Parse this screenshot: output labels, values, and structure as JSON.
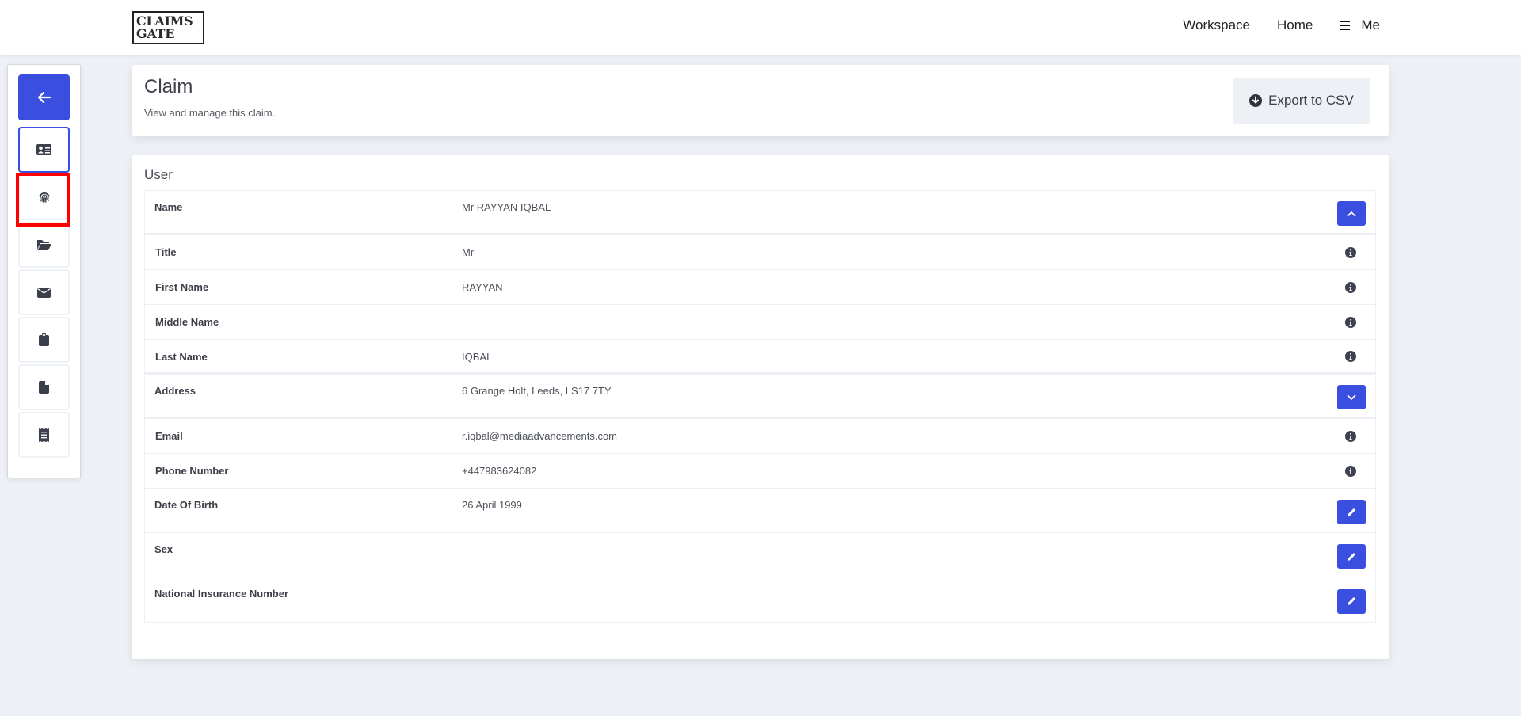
{
  "header": {
    "logo_line1": "CLAIMS",
    "logo_line2": "GATE",
    "nav": [
      {
        "label": "Workspace"
      },
      {
        "label": "Home"
      },
      {
        "label": "Me",
        "icon": "hamburger-icon"
      }
    ]
  },
  "sidebar": {
    "back_icon": "arrow-left-icon",
    "items": [
      {
        "icon": "id-card-icon",
        "active": true
      },
      {
        "icon": "fingerprint-icon",
        "highlighted": true
      },
      {
        "icon": "folder-open-icon"
      },
      {
        "icon": "envelope-icon"
      },
      {
        "icon": "clipboard-icon"
      },
      {
        "icon": "file-icon"
      },
      {
        "icon": "receipt-icon"
      }
    ]
  },
  "page": {
    "title": "Claim",
    "subtitle": "View and manage this claim.",
    "export_label": "Export to CSV",
    "export_icon": "download-circle-icon"
  },
  "user": {
    "section_title": "User",
    "rows": [
      {
        "label": "Name",
        "value": "Mr RAYYAN IQBAL",
        "action": "collapse-button"
      },
      {
        "label": "Title",
        "value": "Mr",
        "action": "info-icon"
      },
      {
        "label": "First Name",
        "value": "RAYYAN",
        "action": "info-icon"
      },
      {
        "label": "Middle Name",
        "value": "",
        "action": "info-icon"
      },
      {
        "label": "Last Name",
        "value": "IQBAL",
        "action": "info-icon"
      },
      {
        "label": "Address",
        "value": "6 Grange Holt, Leeds, LS17 7TY",
        "action": "expand-button"
      },
      {
        "label": "Email",
        "value": "r.iqbal@mediaadvancements.com",
        "action": "info-icon"
      },
      {
        "label": "Phone Number",
        "value": "+447983624082",
        "action": "info-icon"
      },
      {
        "label": "Date Of Birth",
        "value": "26 April 1999",
        "action": "edit-button"
      },
      {
        "label": "Sex",
        "value": "",
        "action": "edit-button"
      },
      {
        "label": "National Insurance Number",
        "value": "",
        "action": "edit-button"
      }
    ]
  },
  "colors": {
    "accent": "#3a4fdf",
    "background": "#edf0f5",
    "highlight": "#ff0000"
  }
}
